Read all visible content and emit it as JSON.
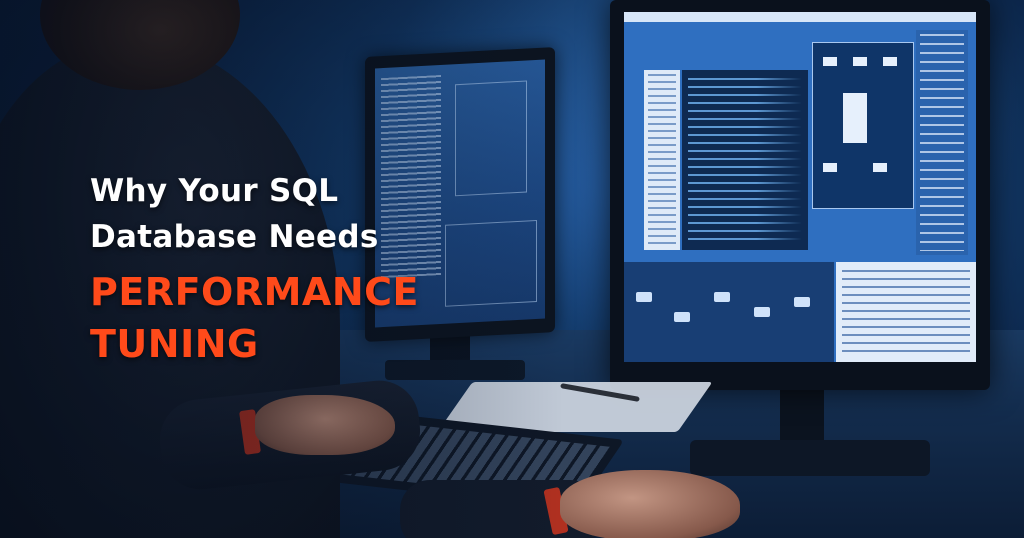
{
  "headline": {
    "line1": "Why Your SQL",
    "line2": "Database Needs",
    "accent_line1": "PERFORMANCE",
    "accent_line2": "TUNING"
  },
  "colors": {
    "accent": "#ff4a1a",
    "text": "#ffffff",
    "background": "#0b2142"
  }
}
